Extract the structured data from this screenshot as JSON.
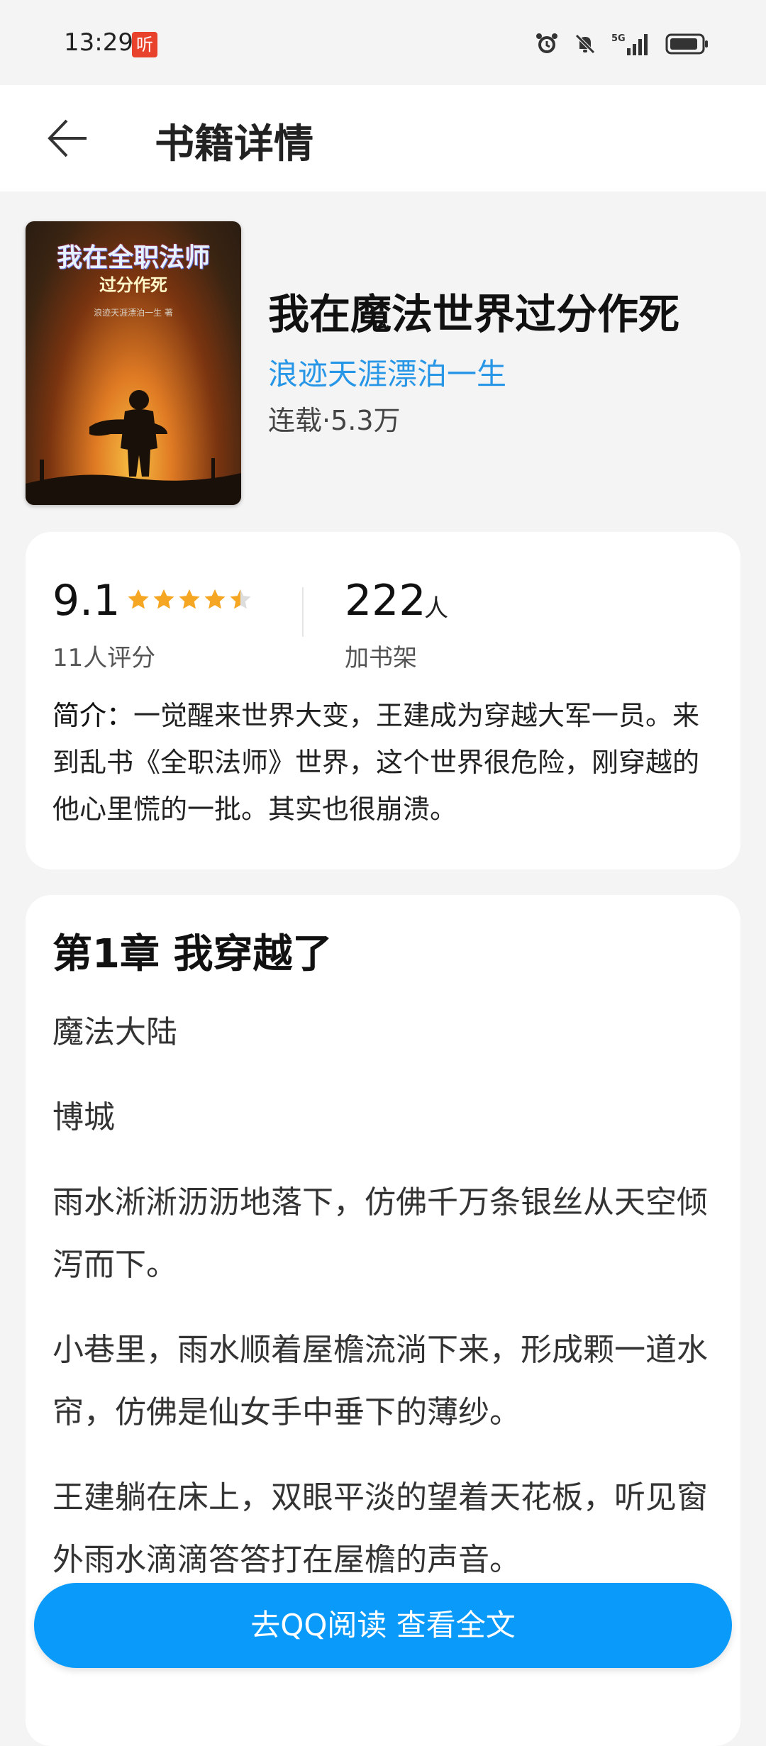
{
  "status_bar": {
    "time": "13:29",
    "badge_label": "听",
    "network": "5G"
  },
  "header": {
    "title": "书籍详情"
  },
  "book": {
    "cover": {
      "title": "我在全职法师",
      "subtitle": "过分作死",
      "author_line": "浪迹天涯漂泊一生 著"
    },
    "title": "我在魔法世界过分作死",
    "author": "浪迹天涯漂泊一生",
    "meta": "连载·5.3万"
  },
  "rating": {
    "score": "9.1",
    "stars": 4.5,
    "raters": "11人评分",
    "bookshelf_count": "222",
    "bookshelf_unit": "人",
    "bookshelf_label": "加书架"
  },
  "intro": {
    "label": "简介：",
    "text": "一觉醒来世界大变，王建成为穿越大军一员。来到乱书《全职法师》世界，这个世界很危险，刚穿越的他心里慌的一批。其实也很崩溃。"
  },
  "chapter": {
    "title": "第1章 我穿越了",
    "paragraphs": [
      "魔法大陆",
      "博城",
      "雨水淅淅沥沥地落下，仿佛千万条银丝从天空倾泻而下。",
      "小巷里，雨水顺着屋檐流淌下来，形成颗一道水帘，仿佛是仙女手中垂下的薄纱。",
      "王建躺在床上，双眼平淡的望着天花板，听见窗外雨水滴滴答答打在屋檐的声音。"
    ]
  },
  "cta": {
    "label": "去QQ阅读 查看全文"
  },
  "colors": {
    "accent": "#0a9afa",
    "author_link": "#2796e6",
    "star": "#f5a623"
  }
}
